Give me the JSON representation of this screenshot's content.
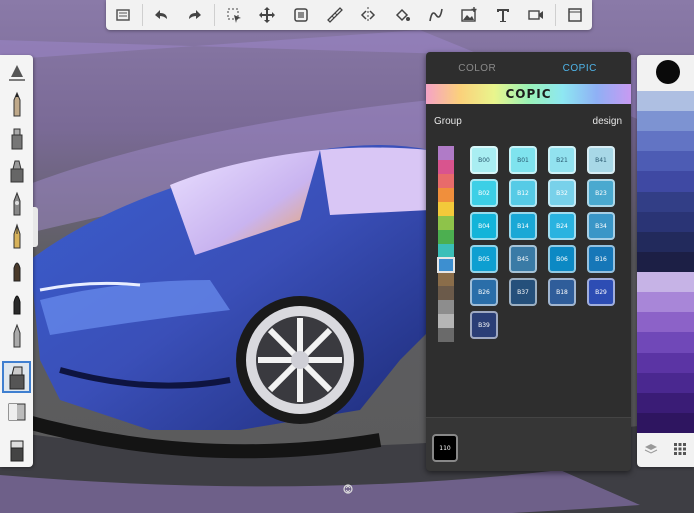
{
  "toolbar": {
    "items": [
      "layers-icon",
      "undo-icon",
      "redo-icon",
      "select-icon",
      "transform-icon",
      "layer-opacity-icon",
      "ruler-icon",
      "symmetry-icon",
      "fill-icon",
      "curve-icon",
      "image-icon",
      "text-icon",
      "video-icon",
      "window-icon"
    ]
  },
  "brushes": {
    "items": [
      "ruler-tool-icon",
      "pencil-brush-icon",
      "marker-brush-icon",
      "marker-wide-brush-icon",
      "airbrush-icon",
      "fountain-pen-brush-icon",
      "ink-brush-icon",
      "paint-brush-icon",
      "soft-pencil-brush-icon",
      "marker-chisel-brush-icon",
      "gradient-brush-icon",
      "eraser-brush-icon"
    ],
    "active_index": 8
  },
  "panel": {
    "tab_color": "COLOR",
    "tab_copic": "COPIC",
    "logo_text": "COPIC",
    "group_label": "Group",
    "group_name": "design",
    "current_code": "110",
    "group_colors": [
      "#b07bc7",
      "#d9548e",
      "#e86b6b",
      "#f08f3c",
      "#f3c93a",
      "#8ec34a",
      "#4caf50",
      "#3bbfb8",
      "#3d8fd0",
      "#8a6d4a",
      "#6b5a4a",
      "#8d8d8d",
      "#b5b5b5",
      "#6a6a6a"
    ],
    "group_selected": 8,
    "swatches": [
      {
        "code": "B00",
        "color": "#a9eef2",
        "text": "light"
      },
      {
        "code": "B01",
        "color": "#7fe3ee",
        "text": "light"
      },
      {
        "code": "B21",
        "color": "#92e2ef",
        "text": "light"
      },
      {
        "code": "B41",
        "color": "#a8d8e7",
        "text": "light"
      },
      {
        "code": "B02",
        "color": "#3ccfe6",
        "text": "dark"
      },
      {
        "code": "B12",
        "color": "#56cbe6",
        "text": "dark"
      },
      {
        "code": "B32",
        "color": "#78d1ea",
        "text": "dark"
      },
      {
        "code": "B23",
        "color": "#4aa9cf",
        "text": "dark"
      },
      {
        "code": "B04",
        "color": "#13b4d9",
        "text": "dark"
      },
      {
        "code": "B14",
        "color": "#1aa8d6",
        "text": "dark"
      },
      {
        "code": "B24",
        "color": "#2ab3e0",
        "text": "dark"
      },
      {
        "code": "B34",
        "color": "#3a96c7",
        "text": "dark"
      },
      {
        "code": "B05",
        "color": "#0e9fd1",
        "text": "dark"
      },
      {
        "code": "B45",
        "color": "#3a7ba6",
        "text": "dark"
      },
      {
        "code": "B06",
        "color": "#0c89c4",
        "text": "dark"
      },
      {
        "code": "B16",
        "color": "#1677b8",
        "text": "dark"
      },
      {
        "code": "B26",
        "color": "#2a6ea9",
        "text": "dark"
      },
      {
        "code": "B37",
        "color": "#25507b",
        "text": "dark"
      },
      {
        "code": "B18",
        "color": "#2f5d9a",
        "text": "dark"
      },
      {
        "code": "B29",
        "color": "#2d4db4",
        "text": "dark"
      },
      {
        "code": "B39",
        "color": "#2b3e76",
        "text": "dark"
      }
    ]
  },
  "right_palette": {
    "colors": [
      "#aebfe2",
      "#7d93d2",
      "#6274c4",
      "#4d5cb4",
      "#3f49a3",
      "#323e86",
      "#2a3475",
      "#222a5c",
      "#1c1f45",
      "#c6b3e6",
      "#a886d8",
      "#8c62c8",
      "#7048b8",
      "#5b34a4",
      "#4a2890",
      "#3a1c76",
      "#2e1560"
    ]
  }
}
